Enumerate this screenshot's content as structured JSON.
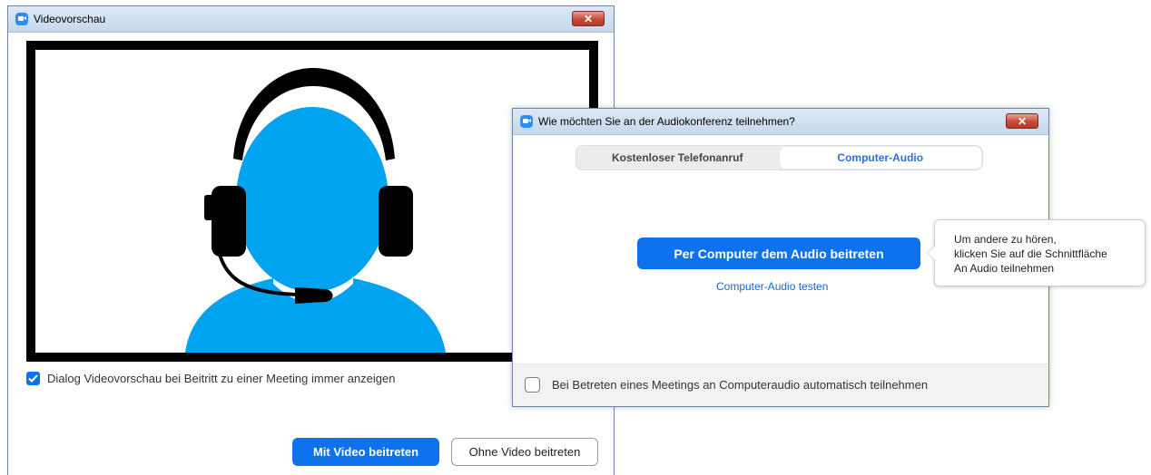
{
  "video_window": {
    "title": "Videovorschau",
    "close_glyph": "✕",
    "avatar_icon": "headset-user-icon",
    "always_show_checkbox": {
      "label": "Dialog Videovorschau bei Beitritt zu einer Meeting immer anzeigen",
      "checked": true
    },
    "join_with_video_label": "Mit Video beitreten",
    "join_without_video_label": "Ohne Video beitreten"
  },
  "audio_dialog": {
    "title": "Wie möchten Sie an der Audiokonferenz teilnehmen?",
    "close_glyph": "✕",
    "tabs": [
      {
        "label": "Kostenloser Telefonanruf",
        "active": false
      },
      {
        "label": "Computer-Audio",
        "active": true
      }
    ],
    "join_audio_label": "Per Computer dem Audio beitreten",
    "test_audio_link": "Computer-Audio testen",
    "auto_join_checkbox": {
      "label": "Bei Betreten eines Meetings an Computeraudio automatisch teilnehmen",
      "checked": false
    }
  },
  "tooltip": {
    "lines": [
      "Um andere zu hören,",
      "klicken Sie auf die Schnittfläche",
      "An Audio teilnehmen"
    ]
  },
  "colors": {
    "accent": "#0e72ed",
    "avatar_blue": "#00a3f0",
    "link": "#1766cf"
  }
}
